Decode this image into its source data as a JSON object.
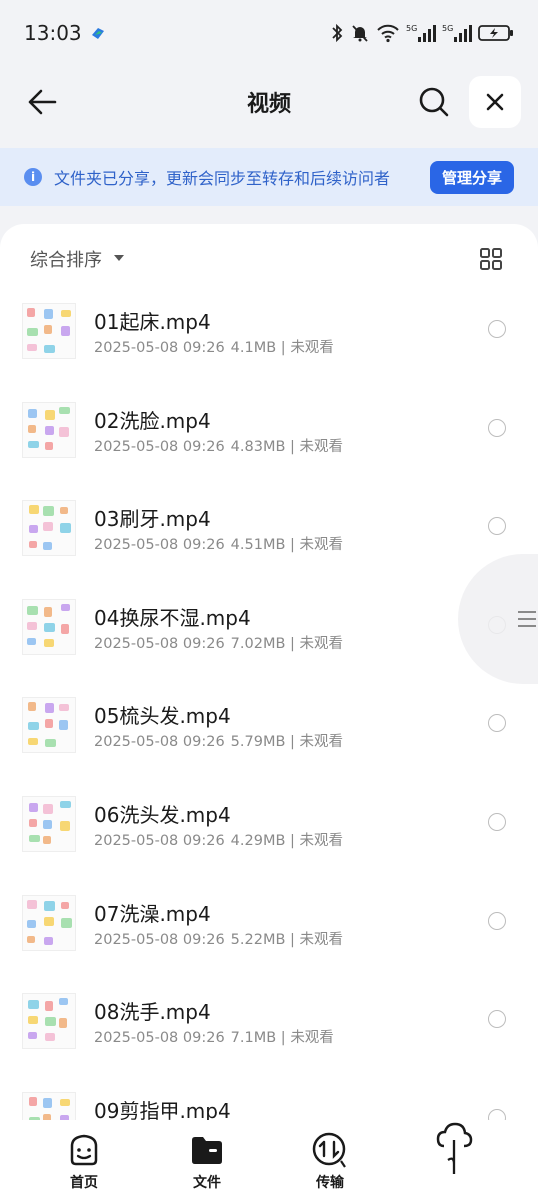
{
  "status_bar": {
    "time": "13:03"
  },
  "header": {
    "title": "视频"
  },
  "banner": {
    "text": "文件夹已分享，更新会同步至转存和后续访问者",
    "button": "管理分享"
  },
  "toolbar": {
    "sort_label": "综合排序"
  },
  "files": [
    {
      "name": "01起床.mp4",
      "date": "2025-05-08 09:26",
      "size": "4.1MB",
      "status": "未观看"
    },
    {
      "name": "02洗脸.mp4",
      "date": "2025-05-08 09:26",
      "size": "4.83MB",
      "status": "未观看"
    },
    {
      "name": "03刷牙.mp4",
      "date": "2025-05-08 09:26",
      "size": "4.51MB",
      "status": "未观看"
    },
    {
      "name": "04换尿不湿.mp4",
      "date": "2025-05-08 09:26",
      "size": "7.02MB",
      "status": "未观看"
    },
    {
      "name": "05梳头发.mp4",
      "date": "2025-05-08 09:26",
      "size": "5.79MB",
      "status": "未观看"
    },
    {
      "name": "06洗头发.mp4",
      "date": "2025-05-08 09:26",
      "size": "4.29MB",
      "status": "未观看"
    },
    {
      "name": "07洗澡.mp4",
      "date": "2025-05-08 09:26",
      "size": "5.22MB",
      "status": "未观看"
    },
    {
      "name": "08洗手.mp4",
      "date": "2025-05-08 09:26",
      "size": "7.1MB",
      "status": "未观看"
    },
    {
      "name": "09剪指甲.mp4",
      "date": "",
      "size": "",
      "status": ""
    }
  ],
  "nav": [
    {
      "label": "首页",
      "icon": "home-face-icon"
    },
    {
      "label": "文件",
      "icon": "folder-icon"
    },
    {
      "label": "传输",
      "icon": "transfer-icon"
    },
    {
      "label": "",
      "icon": "cloud-icon"
    }
  ],
  "colors": {
    "accent": "#2a66e6",
    "banner_bg": "#e3ecfb",
    "banner_text": "#2f62c9"
  }
}
